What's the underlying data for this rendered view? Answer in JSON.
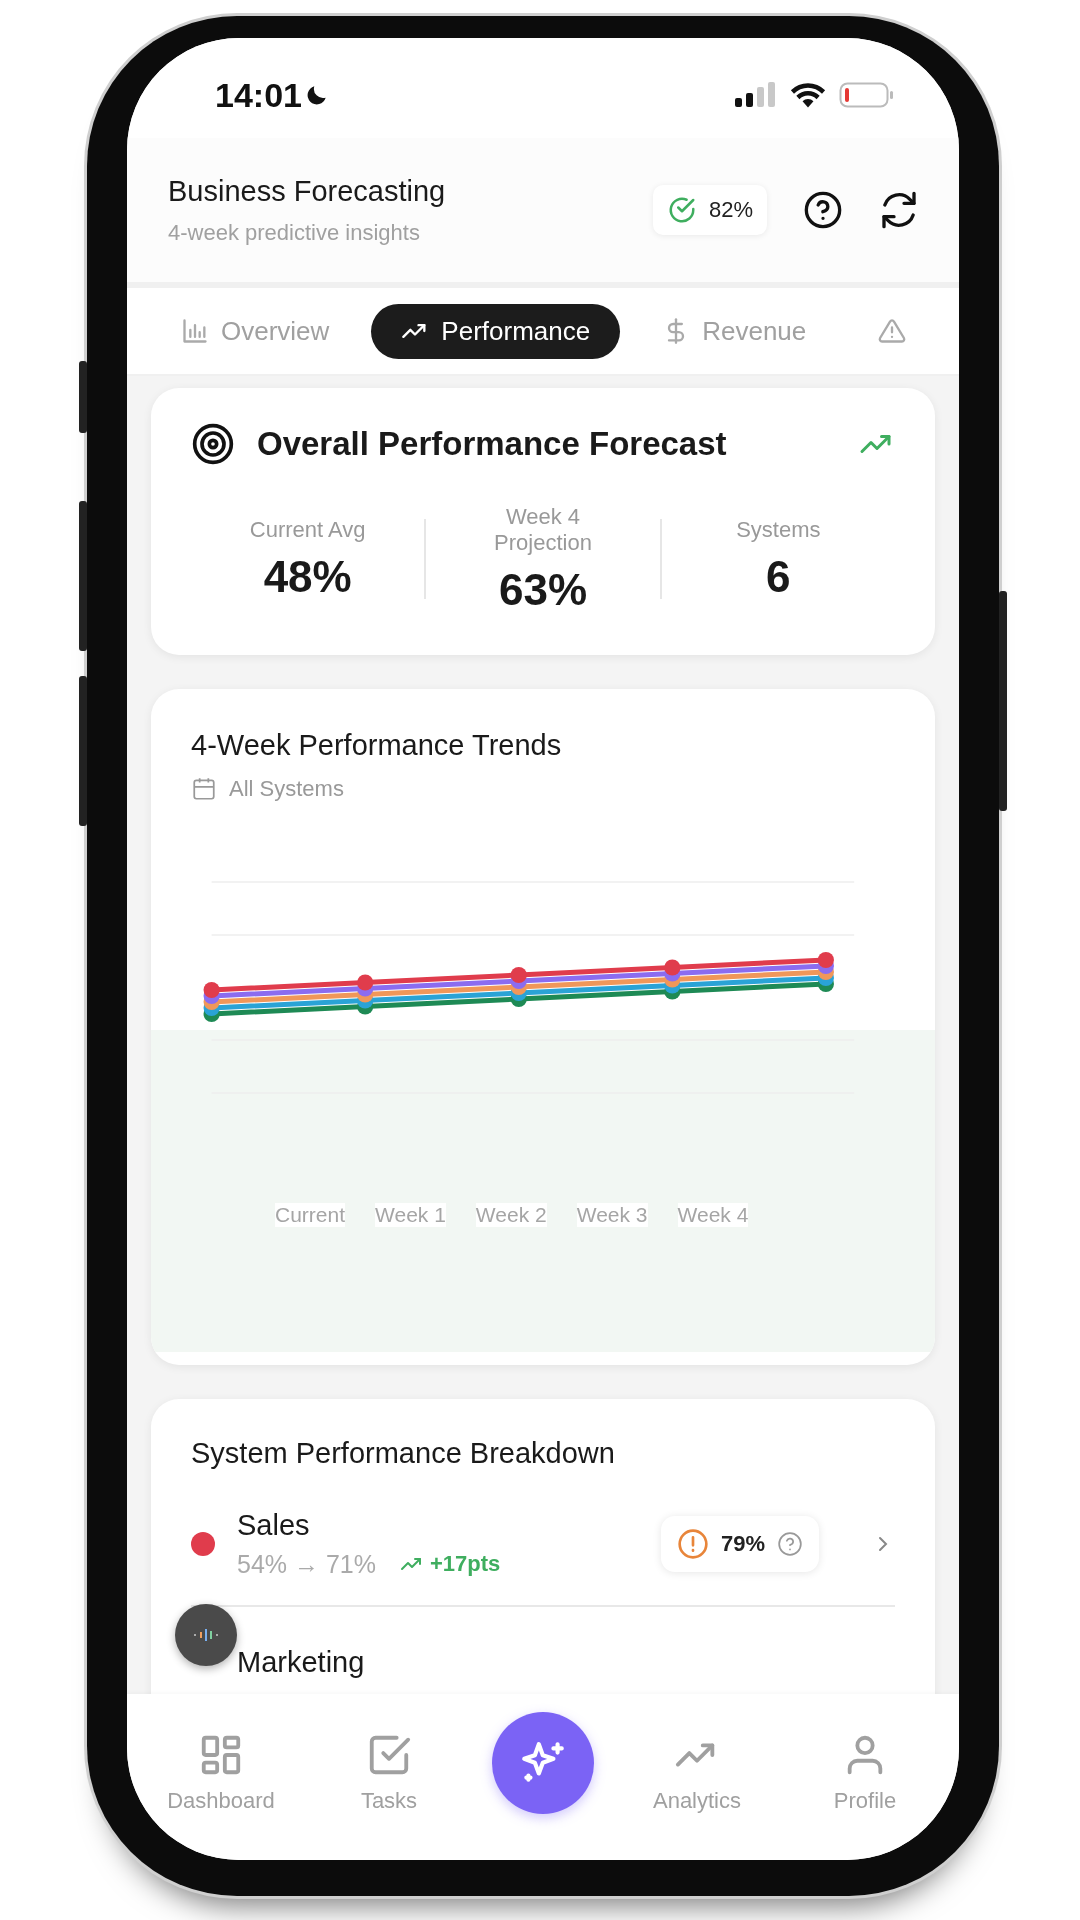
{
  "status_bar": {
    "time": "14:01"
  },
  "header": {
    "title": "Business Forecasting",
    "subtitle": "4-week predictive insights",
    "confidence": "82%"
  },
  "tabs": [
    {
      "label": "Overview",
      "selected": false
    },
    {
      "label": "Performance",
      "selected": true
    },
    {
      "label": "Revenue",
      "selected": false
    },
    {
      "selected": false
    }
  ],
  "overview": {
    "title": "Overall Performance Forecast",
    "stats": [
      {
        "label": "Current Avg",
        "value": "48%"
      },
      {
        "label": "Week 4 Projection",
        "value": "63%"
      },
      {
        "label": "Systems",
        "value": "6"
      }
    ]
  },
  "trends": {
    "title": "4-Week Performance Trends",
    "subtitle": "All Systems",
    "x_labels": [
      "Current",
      "Week 1",
      "Week 2",
      "Week 3",
      "Week 4"
    ],
    "series": [
      {
        "color": "#1e8a55"
      },
      {
        "color": "#2aa3d6"
      },
      {
        "color": "#f0975a"
      },
      {
        "color": "#8b6cf0"
      },
      {
        "color": "#e03c4c"
      }
    ]
  },
  "breakdown": {
    "title": "System Performance Breakdown",
    "systems": [
      {
        "name": "Sales",
        "color": "#e03c4c",
        "range": "54% → 71%",
        "change": "+17pts",
        "score": "79%"
      },
      {
        "name": "Marketing"
      }
    ]
  },
  "nav": [
    {
      "label": "Dashboard",
      "kind": "item"
    },
    {
      "label": "Tasks",
      "kind": "item"
    },
    {
      "kind": "action"
    },
    {
      "label": "Analytics",
      "kind": "item"
    },
    {
      "label": "Profile",
      "kind": "item"
    }
  ]
}
